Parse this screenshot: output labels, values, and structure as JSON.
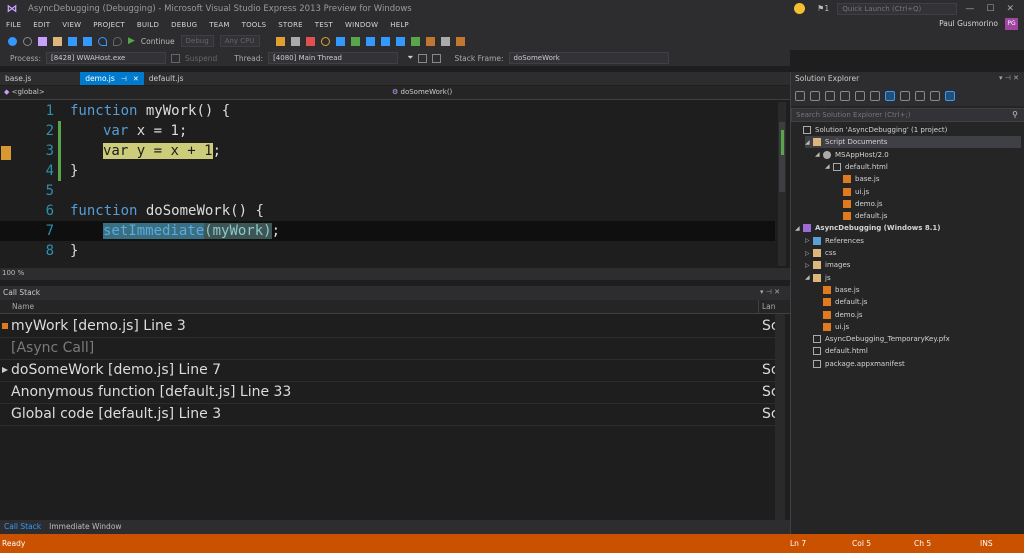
{
  "window": {
    "title": "AsyncDebugging (Debugging) - Microsoft Visual Studio Express 2013 Preview for Windows",
    "notifications": "1",
    "quick_launch_placeholder": "Quick Launch (Ctrl+Q)",
    "min": "—",
    "max": "☐",
    "close": "✕"
  },
  "menu": {
    "items": [
      "FILE",
      "EDIT",
      "VIEW",
      "PROJECT",
      "BUILD",
      "DEBUG",
      "TEAM",
      "TOOLS",
      "STORE",
      "TEST",
      "WINDOW",
      "HELP"
    ],
    "user": "Paul Gusmorino",
    "avatar": "PG"
  },
  "toolbar": {
    "continue": "Continue",
    "config": "Debug",
    "platform": "Any CPU"
  },
  "debug_location": {
    "process_label": "Process:",
    "process_value": "[8428] WWAHost.exe",
    "suspend": "Suspend",
    "thread_label": "Thread:",
    "thread_value": "[4080] Main Thread",
    "stackframe_label": "Stack Frame:",
    "stackframe_value": "doSomeWork"
  },
  "tabs": [
    {
      "label": "base.js",
      "active": false
    },
    {
      "label": "demo.js",
      "active": true
    },
    {
      "label": "default.js",
      "active": false
    }
  ],
  "navbar": {
    "scope": "<global>",
    "member": "doSomeWork()"
  },
  "editor": {
    "zoom": "100 %",
    "lines": [
      {
        "num": "1",
        "kw": "function",
        "rest": " myWork() {"
      },
      {
        "num": "2",
        "kw": "var",
        "rest": " x = 1;"
      },
      {
        "num": "3",
        "kw": "var",
        "rest": " y = x + 1",
        "tail": ";"
      },
      {
        "num": "4",
        "kw": "",
        "rest": "}"
      },
      {
        "num": "5",
        "kw": "",
        "rest": ""
      },
      {
        "num": "6",
        "kw": "function",
        "rest": " doSomeWork() {"
      },
      {
        "num": "7",
        "ident": "setImmediate",
        "args": "(myWork)",
        "tail": ";"
      },
      {
        "num": "8",
        "kw": "",
        "rest": "}"
      }
    ]
  },
  "callstack": {
    "title": "Call Stack",
    "col_name": "Name",
    "col_lang": "Lan",
    "rows": [
      {
        "name": "myWork [demo.js] Line 3",
        "lang": "Sc",
        "gray": false
      },
      {
        "name": "[Async Call]",
        "lang": "",
        "gray": true
      },
      {
        "name": "doSomeWork [demo.js] Line 7",
        "lang": "Sc",
        "gray": false
      },
      {
        "name": "Anonymous function [default.js] Line 33",
        "lang": "Sc",
        "gray": false
      },
      {
        "name": "Global code [default.js] Line 3",
        "lang": "Sc",
        "gray": false
      }
    ]
  },
  "bottom_tabs": [
    "Call Stack",
    "Immediate Window"
  ],
  "status": {
    "ready": "Ready",
    "ln": "Ln 7",
    "col": "Col 5",
    "ch": "Ch 5",
    "ins": "INS"
  },
  "solution_explorer": {
    "title": "Solution Explorer",
    "search_placeholder": "Search Solution Explorer (Ctrl+;)",
    "nodes": [
      {
        "label": "Solution 'AsyncDebugging' (1 project)",
        "indent": 0,
        "icon": "sol",
        "arrow": ""
      },
      {
        "label": "Script Documents",
        "indent": 1,
        "icon": "folder",
        "arrow": "◢",
        "selected": true
      },
      {
        "label": "MSAppHost/2.0",
        "indent": 2,
        "icon": "gear",
        "arrow": "◢"
      },
      {
        "label": "default.html",
        "indent": 3,
        "icon": "file",
        "arrow": "◢"
      },
      {
        "label": "base.js",
        "indent": 4,
        "icon": "js",
        "arrow": ""
      },
      {
        "label": "ui.js",
        "indent": 4,
        "icon": "js",
        "arrow": ""
      },
      {
        "label": "demo.js",
        "indent": 4,
        "icon": "js",
        "arrow": ""
      },
      {
        "label": "default.js",
        "indent": 4,
        "icon": "js",
        "arrow": ""
      },
      {
        "label": "AsyncDebugging (Windows 8.1)",
        "indent": 0,
        "icon": "proj",
        "arrow": "◢",
        "bold": true
      },
      {
        "label": "References",
        "indent": 1,
        "icon": "ref",
        "arrow": "▷"
      },
      {
        "label": "css",
        "indent": 1,
        "icon": "folder",
        "arrow": "▷"
      },
      {
        "label": "images",
        "indent": 1,
        "icon": "folder",
        "arrow": "▷"
      },
      {
        "label": "js",
        "indent": 1,
        "icon": "folder",
        "arrow": "◢"
      },
      {
        "label": "base.js",
        "indent": 2,
        "icon": "js",
        "arrow": ""
      },
      {
        "label": "default.js",
        "indent": 2,
        "icon": "js",
        "arrow": ""
      },
      {
        "label": "demo.js",
        "indent": 2,
        "icon": "js",
        "arrow": ""
      },
      {
        "label": "ui.js",
        "indent": 2,
        "icon": "js",
        "arrow": ""
      },
      {
        "label": "AsyncDebugging_TemporaryKey.pfx",
        "indent": 1,
        "icon": "file",
        "arrow": ""
      },
      {
        "label": "default.html",
        "indent": 1,
        "icon": "file",
        "arrow": ""
      },
      {
        "label": "package.appxmanifest",
        "indent": 1,
        "icon": "file",
        "arrow": ""
      }
    ]
  }
}
